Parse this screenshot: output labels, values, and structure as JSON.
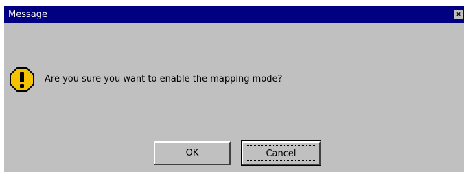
{
  "window": {
    "title": "Message",
    "close_glyph": "×"
  },
  "dialog": {
    "icon": "warning-icon",
    "message": "Are you sure you want to enable the mapping mode?"
  },
  "buttons": {
    "ok_label": "OK",
    "cancel_label": "Cancel"
  },
  "colors": {
    "title_bar": "#000080",
    "dialog_bg": "#c0c0c0",
    "icon_fill": "#f5c400"
  }
}
